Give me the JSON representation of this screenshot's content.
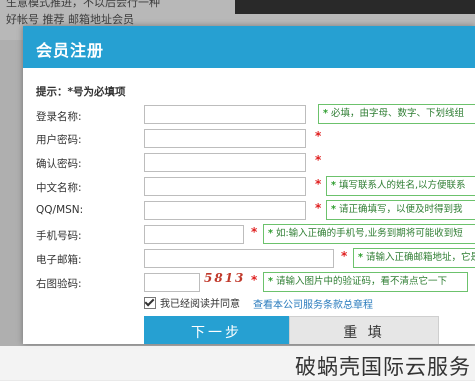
{
  "background": {
    "line1": "生意模式推进，不以后会行一种",
    "line2": "好帐号  推荐  邮箱地址会员"
  },
  "modal": {
    "title": "会员注册",
    "hint": "提示：*号为必填项",
    "fields": [
      {
        "label": "登录名称:",
        "value": "",
        "required": false,
        "tip": "必填，由字母、数字、下划线组"
      },
      {
        "label": "用户密码:",
        "value": "",
        "required": true,
        "tip": ""
      },
      {
        "label": "确认密码:",
        "value": "",
        "required": true,
        "tip": ""
      },
      {
        "label": "中文名称:",
        "value": "",
        "required": true,
        "tip": "填写联系人的姓名,以方便联系"
      },
      {
        "label": "QQ/MSN:",
        "value": "",
        "required": true,
        "tip": "请正确填写，以便及时得到我"
      },
      {
        "label": "手机号码:",
        "value": "",
        "required": true,
        "tip": "如:输入正确的手机号,业务到期将可能收到短"
      },
      {
        "label": "电子邮箱:",
        "value": "",
        "required": true,
        "tip": "请输入正确邮箱地址，它是"
      },
      {
        "label": "右图验码:",
        "value": "",
        "required": true,
        "tip": "请输入图片中的验证码，看不清点它一下"
      }
    ],
    "captcha_text": "5813",
    "agree_label": "我已经阅读并同意",
    "terms_link": "查看本公司服务条款总章程",
    "next_button": "下一步",
    "reset_button": "重 填",
    "tip_mark": "*"
  },
  "watermark": "破蜗壳国际云服务",
  "colors": {
    "accent": "#26a0d2",
    "required": "#e02020",
    "tip_border": "#6cc26c",
    "tip_text": "#2e7d32"
  }
}
